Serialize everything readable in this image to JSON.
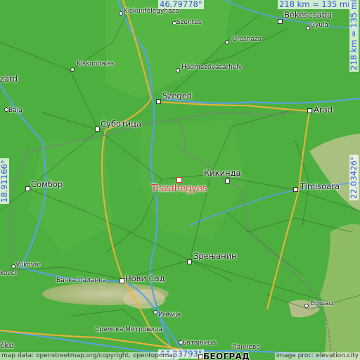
{
  "coordinates": {
    "top": "46.79778°",
    "bottom": "44.83793°",
    "left": "18.91166°",
    "right": "22.03426°"
  },
  "scale": {
    "horizontal": "218 km = 135 mi",
    "vertical": "218 km = 135 mi"
  },
  "target": {
    "name": "Tiszahegyes"
  },
  "places": {
    "kiskunfelegyhaza": "Kiskunfélegyháza",
    "szentes": "Szentes",
    "bekescsaba": "Békéscsaba",
    "gyula": "Gyula",
    "oroshaza": "Orosháza",
    "kiskunhalas": "Kiskunhalas",
    "hodmezovasarhely": "Hódmezővásárhely",
    "szeged": "Szeged",
    "baja": "Baja",
    "arad": "Arad",
    "subotica": "Суботица",
    "kikinda": "Кикинда",
    "sombor": "Сомбор",
    "timisoara": "Timișoara",
    "zrenjanin": "Зрењанин",
    "vukovar": "Vukovar",
    "backapalanka": "Бачка Паланка",
    "novisad": "Нови Сад",
    "vrsac": "Вршац",
    "indjija": "Инђија",
    "sremskamitrovica": "Сремска Митровица",
    "batajnica": "Батајница",
    "pancevo": "Панчево",
    "beograd": "БЕОГРАД",
    "edge_left_top": "zárd",
    "edge_left_bottom": "čko",
    "edge_left_mid": "kovci"
  },
  "attribution": {
    "left": "map data: openstreetmap.org/copyright, opentopomap",
    "right": "image proc: elevation.city"
  },
  "colors": {
    "land": "#4caf3f",
    "land_light": "#74c45a",
    "hills": "#c8b89a",
    "river": "#5aa0e6",
    "major_road": "#f2b13a",
    "border": "#7f7f7f",
    "target": "#e0303a",
    "coordinate_text": "#2b5bd6"
  }
}
